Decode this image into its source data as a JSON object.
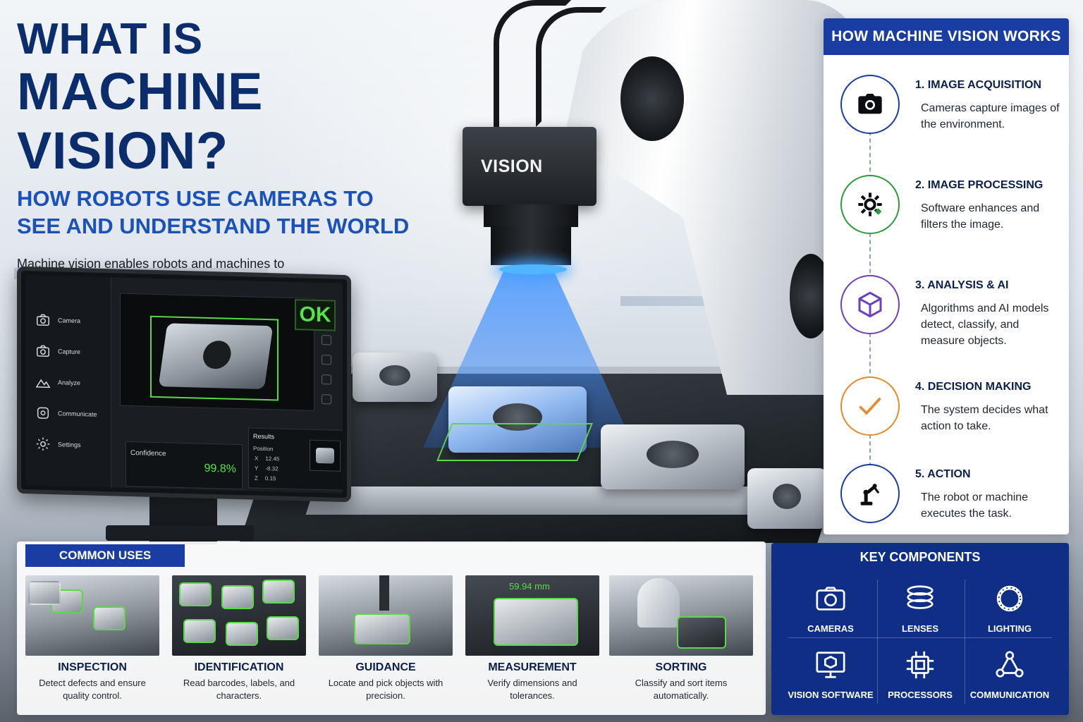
{
  "title": {
    "line1": "WHAT IS",
    "line2": "MACHINE VISION?",
    "subtitle": "HOW ROBOTS USE CAMERAS TO SEE AND UNDERSTAND THE WORLD",
    "intro": "Machine vision enables robots and machines to interpret visual information, make decisions, and take action. It combines cameras, lighting, image processing, and AI to inspect, identify, measure, and guide in real time."
  },
  "camera": {
    "label": "VISION"
  },
  "monitor": {
    "menu": [
      {
        "label": "Camera",
        "icon": "camera-icon"
      },
      {
        "label": "Capture",
        "icon": "camera-icon"
      },
      {
        "label": "Analyze",
        "icon": "mountain-icon"
      },
      {
        "label": "Communicate",
        "icon": "chat-icon"
      },
      {
        "label": "Settings",
        "icon": "gear-icon"
      }
    ],
    "status": "OK",
    "confidence_label": "Confidence",
    "confidence_value": "99.8%",
    "results_title": "Results",
    "position_label": "Position",
    "position": [
      {
        "axis": "X",
        "value": "12.45"
      },
      {
        "axis": "Y",
        "value": "-8.32"
      },
      {
        "axis": "Z",
        "value": "0.15"
      }
    ]
  },
  "works": {
    "heading": "HOW MACHINE VISION WORKS",
    "steps": [
      {
        "title": "1. IMAGE ACQUISITION",
        "desc": "Cameras capture images of the environment.",
        "icon": "camera-icon",
        "color": "#1a3da3"
      },
      {
        "title": "2. IMAGE PROCESSING",
        "desc": "Software enhances and filters the image.",
        "icon": "gear-icon",
        "color": "#2e9a3a"
      },
      {
        "title": "3. ANALYSIS & AI",
        "desc": "Algorithms and AI models detect, classify, and measure objects.",
        "icon": "cube-icon",
        "color": "#6b3fbf"
      },
      {
        "title": "4. DECISION MAKING",
        "desc": "The system decides what action to take.",
        "icon": "checkmark-icon",
        "color": "#e8892b"
      },
      {
        "title": "5. ACTION",
        "desc": "The robot or machine executes the task.",
        "icon": "robot-arm-icon",
        "color": "#1a3da3"
      }
    ]
  },
  "uses": {
    "heading": "COMMON USES",
    "items": [
      {
        "title": "INSPECTION",
        "desc": "Detect defects and ensure quality control."
      },
      {
        "title": "IDENTIFICATION",
        "desc": "Read barcodes, labels, and characters."
      },
      {
        "title": "GUIDANCE",
        "desc": "Locate and pick objects with precision."
      },
      {
        "title": "MEASUREMENT",
        "desc": "Verify dimensions and tolerances.",
        "overlay": "59.94 mm"
      },
      {
        "title": "SORTING",
        "desc": "Classify and sort items automatically."
      }
    ]
  },
  "keys": {
    "heading": "KEY COMPONENTS",
    "items": [
      {
        "label": "CAMERAS",
        "icon": "camera-icon"
      },
      {
        "label": "LENSES",
        "icon": "lens-stack-icon"
      },
      {
        "label": "LIGHTING",
        "icon": "ring-light-icon"
      },
      {
        "label": "VISION SOFTWARE",
        "icon": "monitor-cube-icon"
      },
      {
        "label": "PROCESSORS",
        "icon": "chip-icon"
      },
      {
        "label": "COMMUNICATION",
        "icon": "network-icon"
      }
    ]
  },
  "colors": {
    "navy": "#0b2d6b",
    "accent_blue": "#1a3da3",
    "detect_green": "#5bd84a",
    "beam_blue": "#4fb6ff"
  }
}
